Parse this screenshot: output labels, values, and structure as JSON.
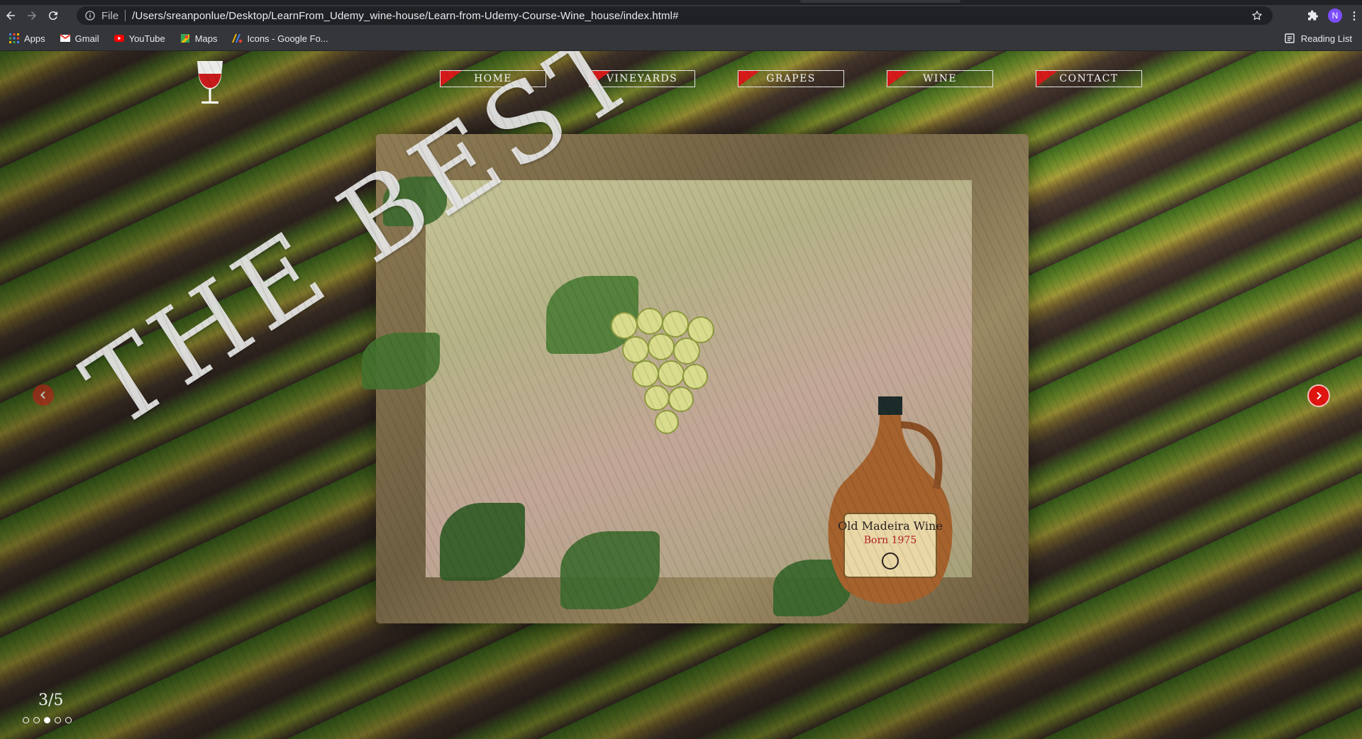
{
  "browser": {
    "file_label": "File",
    "url": "/Users/sreanponlue/Desktop/LearnFrom_Udemy_wine-house/Learn-from-Udemy-Course-Wine_house/index.html#",
    "profile_initial": "N",
    "bookmarks": [
      {
        "label": "Apps",
        "icon": "apps-grid-icon"
      },
      {
        "label": "Gmail",
        "icon": "gmail-icon"
      },
      {
        "label": "YouTube",
        "icon": "youtube-icon"
      },
      {
        "label": "Maps",
        "icon": "maps-icon"
      },
      {
        "label": "Icons - Google Fo...",
        "icon": "google-fonts-icon"
      }
    ],
    "reading_list": "Reading List"
  },
  "page": {
    "nav": [
      "HOME",
      "VINEYARDS",
      "GRAPES",
      "WINE",
      "CONTACT"
    ],
    "headline": "THE BEST QUALITY",
    "slide_counter": "3/5",
    "slides_total": 5,
    "active_slide": 3,
    "jug_label_line1": "Old Madeira Wine",
    "jug_label_line2": "Born 1975",
    "accent_color": "#d61a1a"
  }
}
